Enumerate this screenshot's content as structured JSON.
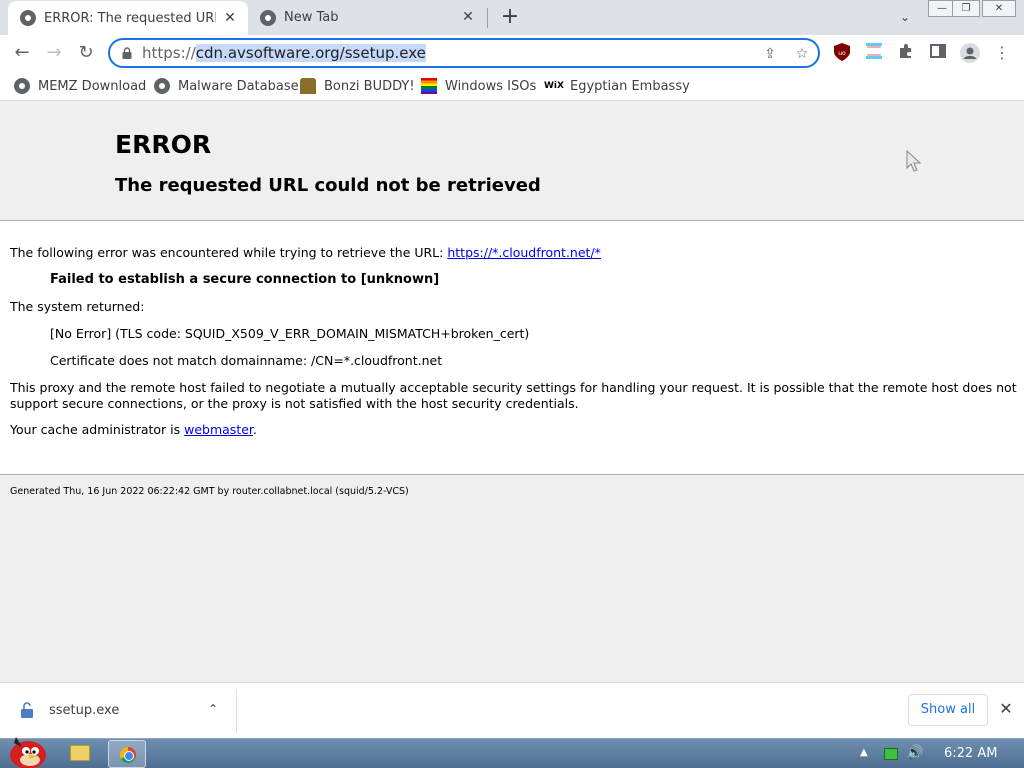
{
  "browser": {
    "tabs": [
      {
        "title": "ERROR: The requested URL co",
        "active": true
      },
      {
        "title": "New Tab",
        "active": false
      }
    ],
    "new_tab": "+",
    "tab_close": "✕",
    "tab_search_icon": "⌄",
    "window_controls": {
      "minimize": "—",
      "restore": "❐",
      "close": "✕"
    }
  },
  "toolbar": {
    "back": "←",
    "forward": "→",
    "reload": "↻",
    "url": {
      "scheme": "https://",
      "host": "cdn.avsoftware.org/ssetup.exe"
    },
    "share_icon": "⇪",
    "bookmark_star": "☆",
    "menu_icon": "⋮"
  },
  "bookmarks": [
    {
      "label": "MEMZ Download",
      "icon": "globe"
    },
    {
      "label": "Malware Database",
      "icon": "globe"
    },
    {
      "label": "Bonzi BUDDY!",
      "icon": "bonzi"
    },
    {
      "label": "Windows ISOs",
      "icon": "rainbow"
    },
    {
      "label": "Egyptian Embassy",
      "icon": "wix",
      "icon_text": "WiX"
    }
  ],
  "page": {
    "heading": "ERROR",
    "subheading": "The requested URL could not be retrieved",
    "intro": "The following error was encountered while trying to retrieve the URL: ",
    "intro_link": "https://*.cloudfront.net/*",
    "error_bold": "Failed to establish a secure connection to [unknown]",
    "system_returned": "The system returned:",
    "tls_code": "[No Error] (TLS code: SQUID_X509_V_ERR_DOMAIN_MISMATCH+broken_cert)",
    "cert_mismatch": "Certificate does not match domainname: /CN=*.cloudfront.net",
    "proxy_line1": "This proxy and the remote host failed to negotiate a mutually acceptable security settings for handling your request. It is possible that the remote host does not",
    "proxy_line2": "support secure connections, or the proxy is not satisfied with the host security credentials.",
    "admin_prefix": "Your cache administrator is ",
    "admin_link": "webmaster",
    "admin_suffix": ".",
    "generated": "Generated Thu, 16 Jun 2022 06:22:42 GMT by router.collabnet.local (squid/5.2-VCS)"
  },
  "downloads": {
    "file_name": "ssetup.exe",
    "chevron": "⌃",
    "show_all": "Show all",
    "close": "✕"
  },
  "taskbar": {
    "tray_arrow": "▲",
    "volume_icon": "🔊",
    "clock": "6:22 AM"
  }
}
